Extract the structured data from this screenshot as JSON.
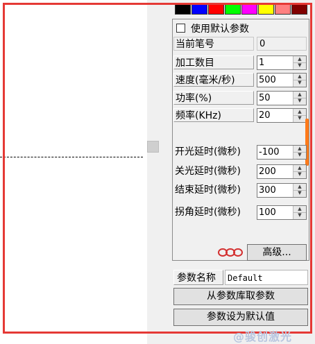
{
  "palette": {
    "swatches": [
      "#000000",
      "#0000ff",
      "#ff0000",
      "#00ff00",
      "#ff00ff",
      "#ffff00",
      "#ff8080",
      "#800000"
    ]
  },
  "params": {
    "use_default_label": "使用默认参数",
    "rows": [
      {
        "label": "当前笔号",
        "value": "0"
      },
      {
        "label": "加工数目",
        "value": "1"
      },
      {
        "label": "速度(毫米/秒)",
        "value": "500"
      },
      {
        "label": "功率(%)",
        "value": "50"
      },
      {
        "label": "频率(KHz)",
        "value": "20"
      },
      {
        "label": "开光延时(微秒)",
        "value": "-100"
      },
      {
        "label": "关光延时(微秒)",
        "value": "200"
      },
      {
        "label": "结束延时(微秒)",
        "value": "300"
      },
      {
        "label": "拐角延时(微秒)",
        "value": "100"
      }
    ],
    "advanced_label": "高级...",
    "name_label": "参数名称",
    "name_value": "Default",
    "load_button": "从参数库取参数",
    "set_default_button": "参数设为默认值"
  },
  "watermark": "@骏创激光",
  "colors": {
    "accent": "#ff7a1a",
    "frame": "#e53935",
    "ring_icon": "#d32f2f"
  }
}
